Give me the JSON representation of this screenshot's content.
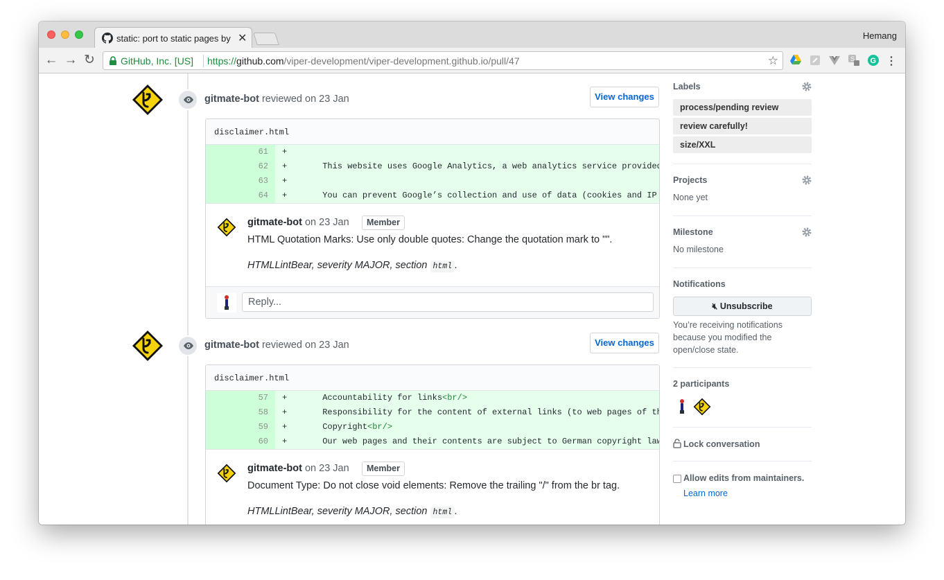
{
  "browser": {
    "tab_title": "static: port to static pages by",
    "tab_close": "✕",
    "profile_name": "Hemang",
    "nav_back": "←",
    "nav_forward": "→",
    "nav_reload": "↻",
    "security_label": "GitHub, Inc. [US]",
    "url_scheme": "https://",
    "url_host": "github.com",
    "url_path": "/viper-development/viper-development.github.io/pull/47",
    "star": "☆",
    "menu": "⋮",
    "extensions": [
      "google-drive-icon",
      "reader-icon",
      "vue-devtools-icon",
      "shopping-icon",
      "grammarly-icon"
    ]
  },
  "reviews": [
    {
      "author": "gitmate-bot",
      "action": "reviewed on 23 Jan",
      "view_changes": "View changes",
      "file_name": "disclaimer.html",
      "diff_lines": [
        {
          "num": "61",
          "sign": "+",
          "code": ""
        },
        {
          "num": "62",
          "sign": "+",
          "code": "This website uses Google Analytics, a web analytics service provided by Go"
        },
        {
          "num": "63",
          "sign": "+",
          "code": ""
        },
        {
          "num": "64",
          "sign": "+",
          "code": "You can prevent Google’s collection and use of data (cookies and IP addres"
        }
      ],
      "comment": {
        "author": "gitmate-bot",
        "date": "on 23 Jan",
        "badge": "Member",
        "body": "HTML Quotation Marks: Use only double quotes: Change the quotation mark to \"\".",
        "meta_prefix": "HTMLLintBear, severity MAJOR, section",
        "meta_code": "html",
        "meta_suffix": "."
      },
      "reply_placeholder": "Reply..."
    },
    {
      "author": "gitmate-bot",
      "action": "reviewed on 23 Jan",
      "view_changes": "View changes",
      "file_name": "disclaimer.html",
      "diff_lines": [
        {
          "num": "57",
          "sign": "+",
          "code": "Accountability for links",
          "tag": "<br/>"
        },
        {
          "num": "58",
          "sign": "+",
          "code": "Responsibility for the content of external links (to web pages of third pa"
        },
        {
          "num": "59",
          "sign": "+",
          "code": "Copyright",
          "tag": "<br/>"
        },
        {
          "num": "60",
          "sign": "+",
          "code": "Our web pages and their contents are subject to German copyright law. Unle"
        }
      ],
      "comment": {
        "author": "gitmate-bot",
        "date": "on 23 Jan",
        "badge": "Member",
        "body": "Document Type: Do not close void elements: Remove the trailing \"/\" from the br tag.",
        "meta_prefix": "HTMLLintBear, severity MAJOR, section",
        "meta_code": "html",
        "meta_suffix": "."
      }
    }
  ],
  "sidebar": {
    "labels_title": "Labels",
    "labels": [
      "process/pending review",
      "review carefully!",
      "size/XXL"
    ],
    "projects_title": "Projects",
    "projects_value": "None yet",
    "milestone_title": "Milestone",
    "milestone_value": "No milestone",
    "notifications_title": "Notifications",
    "unsubscribe_label": "Unsubscribe",
    "notifications_reason": "You’re receiving notifications because you modified the open/close state.",
    "participants_title": "2 participants",
    "lock_label": "Lock conversation",
    "allow_edits_label": "Allow edits from maintainers.",
    "learn_more": "Learn more"
  }
}
